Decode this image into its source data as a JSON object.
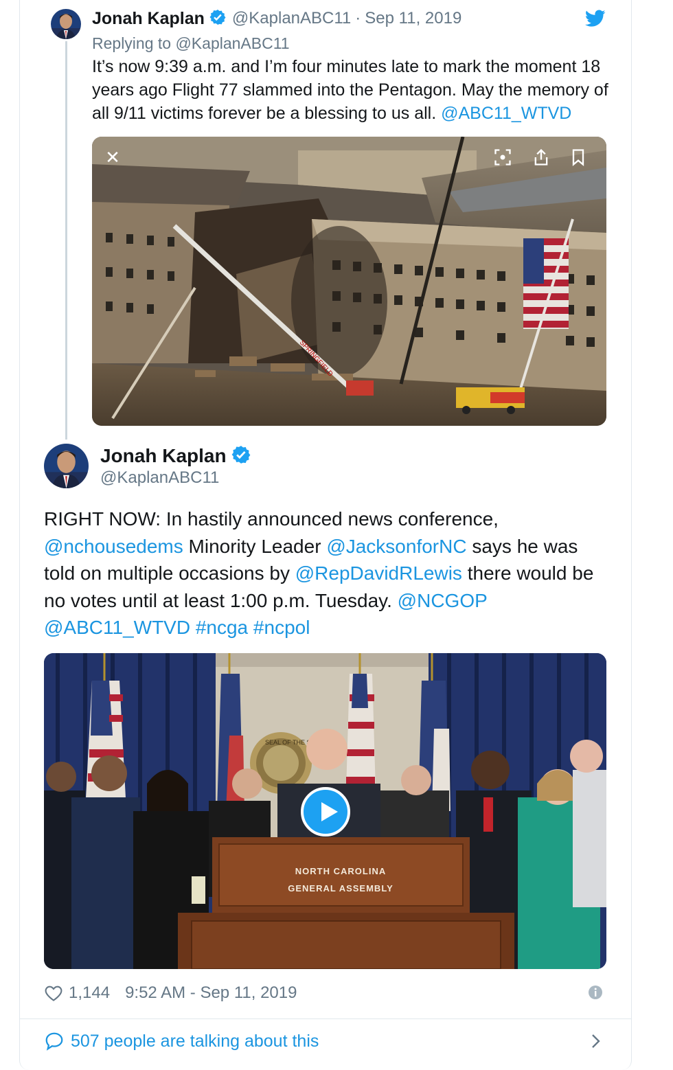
{
  "reply_tweet": {
    "author_name": "Jonah Kaplan",
    "author_handle": "@KaplanABC11",
    "separator": "·",
    "date": "Sep 11, 2019",
    "replying_to": "Replying to @KaplanABC11",
    "text_main": "It’s now 9:39 a.m. and I’m four minutes late to mark the moment 18 years ago Flight 77 slammed into the Pentagon. May the memory of all 9/11 victims forever be a blessing to us all. ",
    "mention": "@ABC11_WTVD"
  },
  "main_tweet": {
    "author_name": "Jonah Kaplan",
    "author_handle": "@KaplanABC11",
    "text": {
      "part1": "RIGHT NOW: In hastily announced news conference, ",
      "mention1": "@nchousedems",
      "part2": " Minority Leader ",
      "mention2": "@JacksonforNC",
      "part3": " says he was told on multiple occasions by ",
      "mention3": "@RepDavidRLewis",
      "part4": " there would be no votes until at least 1:00 p.m. Tuesday. ",
      "mention4": "@NCGOP",
      "mention5": "@ABC11_WTVD",
      "hashtag1": "#ncga",
      "hashtag2": "#ncpol"
    },
    "video": {
      "podium_line1": "NORTH CAROLINA",
      "podium_line2": "GENERAL ASSEMBLY",
      "seal_text": "SEAL OF THE STATE"
    },
    "likes": "1,144",
    "timestamp": "9:52 AM - Sep 11, 2019",
    "conversation": "507 people are talking about this"
  },
  "media_photo": {
    "crane_label": "SPRINGFIELD"
  },
  "colors": {
    "link": "#1b95e0",
    "verified": "#1da1f2",
    "text": "#14171a",
    "muted": "#657786"
  },
  "icons": [
    "verified-badge-icon",
    "twitter-bird-icon",
    "close-icon",
    "zoom-icon",
    "share-icon",
    "bookmark-icon",
    "play-icon",
    "heart-icon",
    "info-icon",
    "reply-bubble-icon",
    "chevron-right-icon"
  ]
}
